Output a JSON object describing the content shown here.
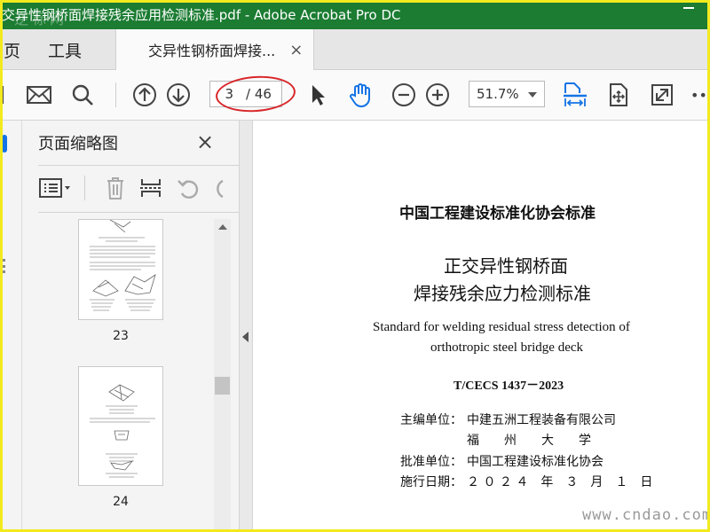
{
  "window": {
    "title": "交异性钢桥面焊接残余应用检测标准.pdf - Adobe Acrobat Pro DC",
    "watermark": "逆标网"
  },
  "menubar": {
    "items": [
      "页",
      "工具"
    ],
    "tab_label": "交异性钢桥面焊接...",
    "tab_close": "×"
  },
  "toolbar": {
    "icons": [
      "save-icon",
      "mail-icon",
      "search-icon",
      "prev-page-icon",
      "next-page-icon",
      "select-cursor-icon",
      "hand-tool-icon",
      "zoom-out-icon",
      "zoom-in-icon",
      "fit-width-icon",
      "rotate-view-icon",
      "fullscreen-icon",
      "more-icon"
    ],
    "page_current": "3",
    "page_total": "/ 46",
    "zoom_value": "51.7%",
    "more_label": "•••",
    "highlight_color": "#d8262a"
  },
  "sidebar": {
    "title": "页面缩略图",
    "close": "×",
    "tools": [
      "options-icon",
      "delete-icon",
      "insert-page-icon",
      "undo-icon",
      "redo-icon"
    ],
    "thumbnails": [
      {
        "page_label": "23"
      },
      {
        "page_label": "24"
      }
    ]
  },
  "document": {
    "org_header": "中国工程建设标准化协会标准",
    "title_line1": "正交异性钢桥面",
    "title_line2": "焊接残余应力检测标准",
    "en_line1": "Standard for welding residual stress detection of",
    "en_line2": "orthotropic steel bridge deck",
    "code": "T/CECS 1437－2023",
    "editor_label": "主编单位：",
    "editor_value1": "中建五洲工程装备有限公司",
    "editor_value2": "福　　州　　大　　学",
    "approver_label": "批准单位：",
    "approver_value": "中国工程建设标准化协会",
    "date_label": "施行日期：",
    "date_value": "２ ０ ２ ４　年　３　月　１　日"
  },
  "footer": {
    "site": "www.cndao.com"
  },
  "colors": {
    "titlebar": "#1b7c32",
    "frame": "#f2ea1e",
    "accent_blue": "#1473e6"
  }
}
